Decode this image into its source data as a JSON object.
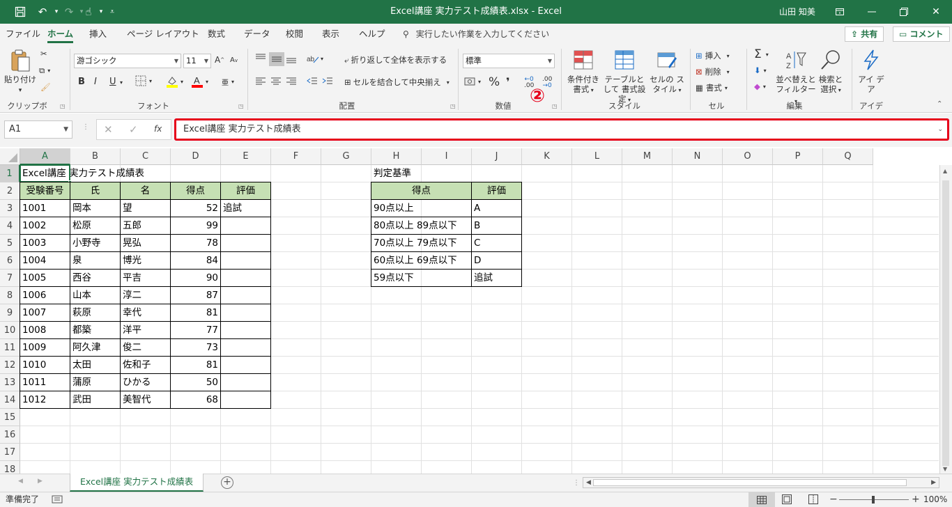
{
  "window": {
    "title": "Excel講座 実力テスト成績表.xlsx  -  Excel",
    "user": "山田 知美"
  },
  "menu": {
    "tabs": [
      "ファイル",
      "ホーム",
      "挿入",
      "ページ レイアウト",
      "数式",
      "データ",
      "校閲",
      "表示",
      "ヘルプ"
    ],
    "active": "ホーム",
    "tell_me": "実行したい作業を入力してください",
    "share": "共有",
    "comment": "コメント"
  },
  "ribbon": {
    "clipboard": {
      "paste": "貼り付け",
      "label": "クリップボード"
    },
    "font": {
      "name": "游ゴシック",
      "size": "11",
      "label": "フォント",
      "increase": "A",
      "decrease": "A",
      "bold": "B",
      "italic": "I",
      "underline": "U"
    },
    "alignment": {
      "wrap": "折り返して全体を表示する",
      "merge": "セルを結合して中央揃え",
      "label": "配置"
    },
    "number": {
      "format": "標準",
      "percent": "%",
      "comma": "❜",
      "label": "数値"
    },
    "styles": {
      "conditional": "条件付き 書式",
      "table": "テーブルとして 書式設定",
      "cell": "セルの スタイル",
      "label": "スタイル"
    },
    "cells": {
      "insert": "挿入",
      "delete": "削除",
      "format": "書式",
      "label": "セル"
    },
    "editing": {
      "sort": "並べ替えと フィルター",
      "find": "検索と 選択",
      "label": "編集"
    },
    "ideas": {
      "btn": "アイ デア",
      "label": "アイデア"
    },
    "annotation": "②"
  },
  "formula_bar": {
    "name_box": "A1",
    "formula": "Excel講座 実力テスト成績表",
    "fx": "fx"
  },
  "grid": {
    "columns": [
      "A",
      "B",
      "C",
      "D",
      "E",
      "F",
      "G",
      "H",
      "I",
      "J",
      "K",
      "L",
      "M",
      "N",
      "O",
      "P",
      "Q"
    ],
    "rows": [
      "1",
      "2",
      "3",
      "4",
      "5",
      "6",
      "7",
      "8",
      "9",
      "10",
      "11",
      "12",
      "13",
      "14",
      "15",
      "16",
      "17",
      "18"
    ],
    "title_cell": "Excel講座 実力テスト成績表",
    "headers": [
      "受験番号",
      "氏",
      "名",
      "得点",
      "評価"
    ],
    "records": [
      [
        "1001",
        "岡本",
        "望",
        "52",
        "追試"
      ],
      [
        "1002",
        "松原",
        "五郎",
        "99",
        ""
      ],
      [
        "1003",
        "小野寺",
        "晃弘",
        "78",
        ""
      ],
      [
        "1004",
        "泉",
        "博光",
        "84",
        ""
      ],
      [
        "1005",
        "西谷",
        "平吉",
        "90",
        ""
      ],
      [
        "1006",
        "山本",
        "淳二",
        "87",
        ""
      ],
      [
        "1007",
        "萩原",
        "幸代",
        "81",
        ""
      ],
      [
        "1008",
        "都築",
        "洋平",
        "77",
        ""
      ],
      [
        "1009",
        "阿久津",
        "俊二",
        "73",
        ""
      ],
      [
        "1010",
        "太田",
        "佐和子",
        "81",
        ""
      ],
      [
        "1011",
        "蒲原",
        "ひかる",
        "50",
        ""
      ],
      [
        "1012",
        "武田",
        "美智代",
        "68",
        ""
      ]
    ],
    "criteria_title": "判定基準",
    "criteria_headers": [
      "得点",
      "評価"
    ],
    "criteria": [
      [
        "90点以上",
        "A"
      ],
      [
        "80点以上 89点以下",
        "B"
      ],
      [
        "70点以上 79点以下",
        "C"
      ],
      [
        "60点以上 69点以下",
        "D"
      ],
      [
        "59点以下",
        "追試"
      ]
    ]
  },
  "sheets": {
    "active": "Excel講座 実力テスト成績表"
  },
  "status": {
    "ready": "準備完了",
    "zoom": "100%"
  },
  "colors": {
    "excel_green": "#217346",
    "header_fill": "#c6e0b4",
    "highlight_red": "#e6001a"
  }
}
